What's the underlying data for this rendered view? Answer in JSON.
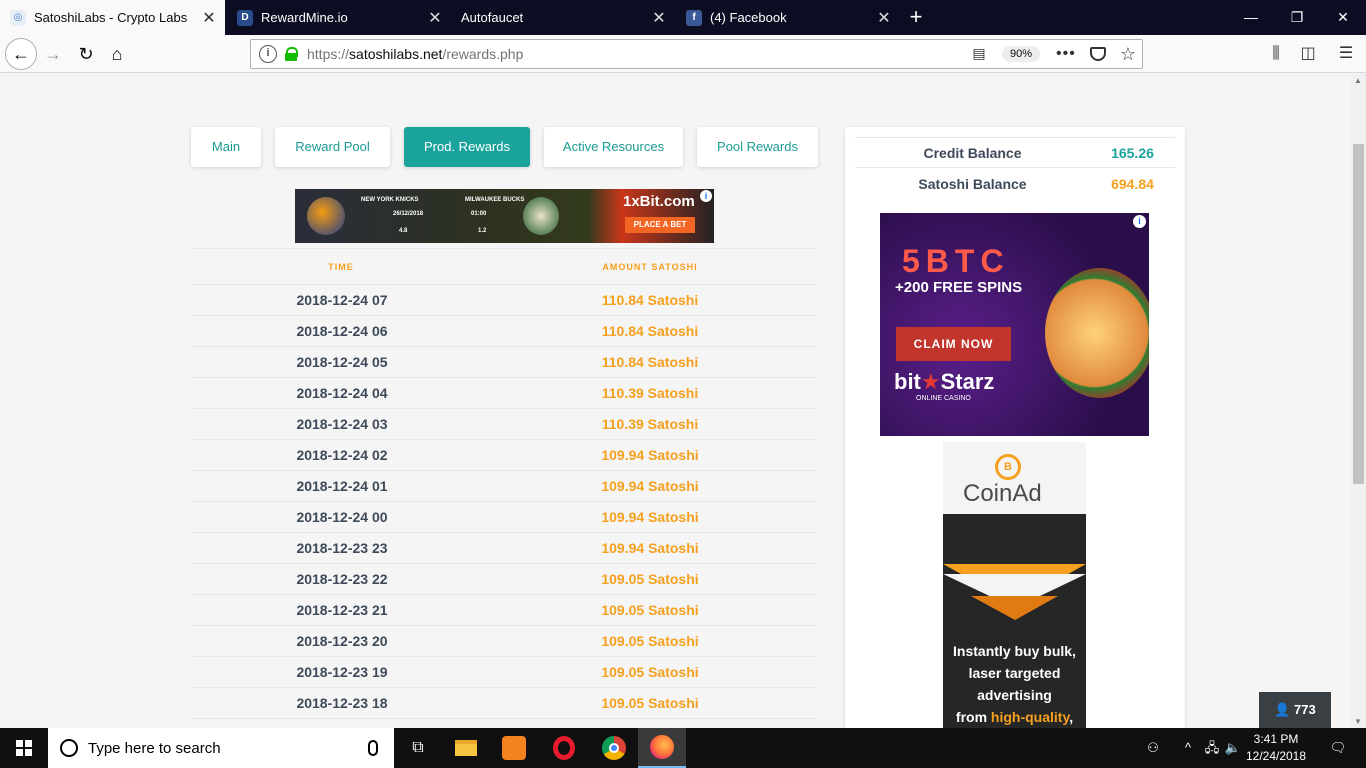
{
  "browser": {
    "tabs": [
      {
        "title": "SatoshiLabs - Crypto Labs",
        "active": true
      },
      {
        "title": "RewardMine.io",
        "active": false
      },
      {
        "title": "Autofaucet",
        "active": false
      },
      {
        "title": "(4) Facebook",
        "active": false
      }
    ],
    "url_prefix": "https://",
    "url_host": "satoshilabs.net",
    "url_path": "/rewards.php",
    "zoom": "90%"
  },
  "nav": {
    "tabs": [
      "Main",
      "Reward Pool",
      "Prod. Rewards",
      "Active Resources",
      "Pool Rewards"
    ],
    "active_index": 2
  },
  "ad_banner": {
    "team1": "NEW YORK KNICKS",
    "team2": "MILWAUKEE BUCKS",
    "date": "26/12/2018",
    "time": "01:00",
    "odds1": "4.8",
    "odds2": "1.2",
    "brand": "1xBit.com",
    "cta": "PLACE A BET"
  },
  "rewards_table": {
    "headers": [
      "TIME",
      "AMOUNT SATOSHI"
    ],
    "rows": [
      {
        "time": "2018-12-24 07",
        "amount": "110.84 Satoshi"
      },
      {
        "time": "2018-12-24 06",
        "amount": "110.84 Satoshi"
      },
      {
        "time": "2018-12-24 05",
        "amount": "110.84 Satoshi"
      },
      {
        "time": "2018-12-24 04",
        "amount": "110.39 Satoshi"
      },
      {
        "time": "2018-12-24 03",
        "amount": "110.39 Satoshi"
      },
      {
        "time": "2018-12-24 02",
        "amount": "109.94 Satoshi"
      },
      {
        "time": "2018-12-24 01",
        "amount": "109.94 Satoshi"
      },
      {
        "time": "2018-12-24 00",
        "amount": "109.94 Satoshi"
      },
      {
        "time": "2018-12-23 23",
        "amount": "109.94 Satoshi"
      },
      {
        "time": "2018-12-23 22",
        "amount": "109.05 Satoshi"
      },
      {
        "time": "2018-12-23 21",
        "amount": "109.05 Satoshi"
      },
      {
        "time": "2018-12-23 20",
        "amount": "109.05 Satoshi"
      },
      {
        "time": "2018-12-23 19",
        "amount": "109.05 Satoshi"
      },
      {
        "time": "2018-12-23 18",
        "amount": "109.05 Satoshi"
      }
    ]
  },
  "balances": {
    "credit_label": "Credit Balance",
    "credit_value": "165.26",
    "credit_color": "#1aa39c",
    "satoshi_label": "Satoshi Balance",
    "satoshi_value": "694.84",
    "satoshi_color": "#f5a01e"
  },
  "casino_ad": {
    "headline": "5BTC",
    "spins": "+200 FREE SPINS",
    "cta": "CLAIM NOW",
    "brand_a": "bit",
    "brand_b": "Starz",
    "sub": "ONLINE CASINO"
  },
  "coinad": {
    "logo": "CoinAd",
    "line1": "Instantly buy bulk,",
    "line2": "laser targeted",
    "line3": "advertising",
    "line4a": "from ",
    "line4b": "high-quality",
    "line4c": ","
  },
  "online_badge": "773",
  "taskbar": {
    "search_placeholder": "Type here to search",
    "time": "3:41 PM",
    "date": "12/24/2018"
  }
}
